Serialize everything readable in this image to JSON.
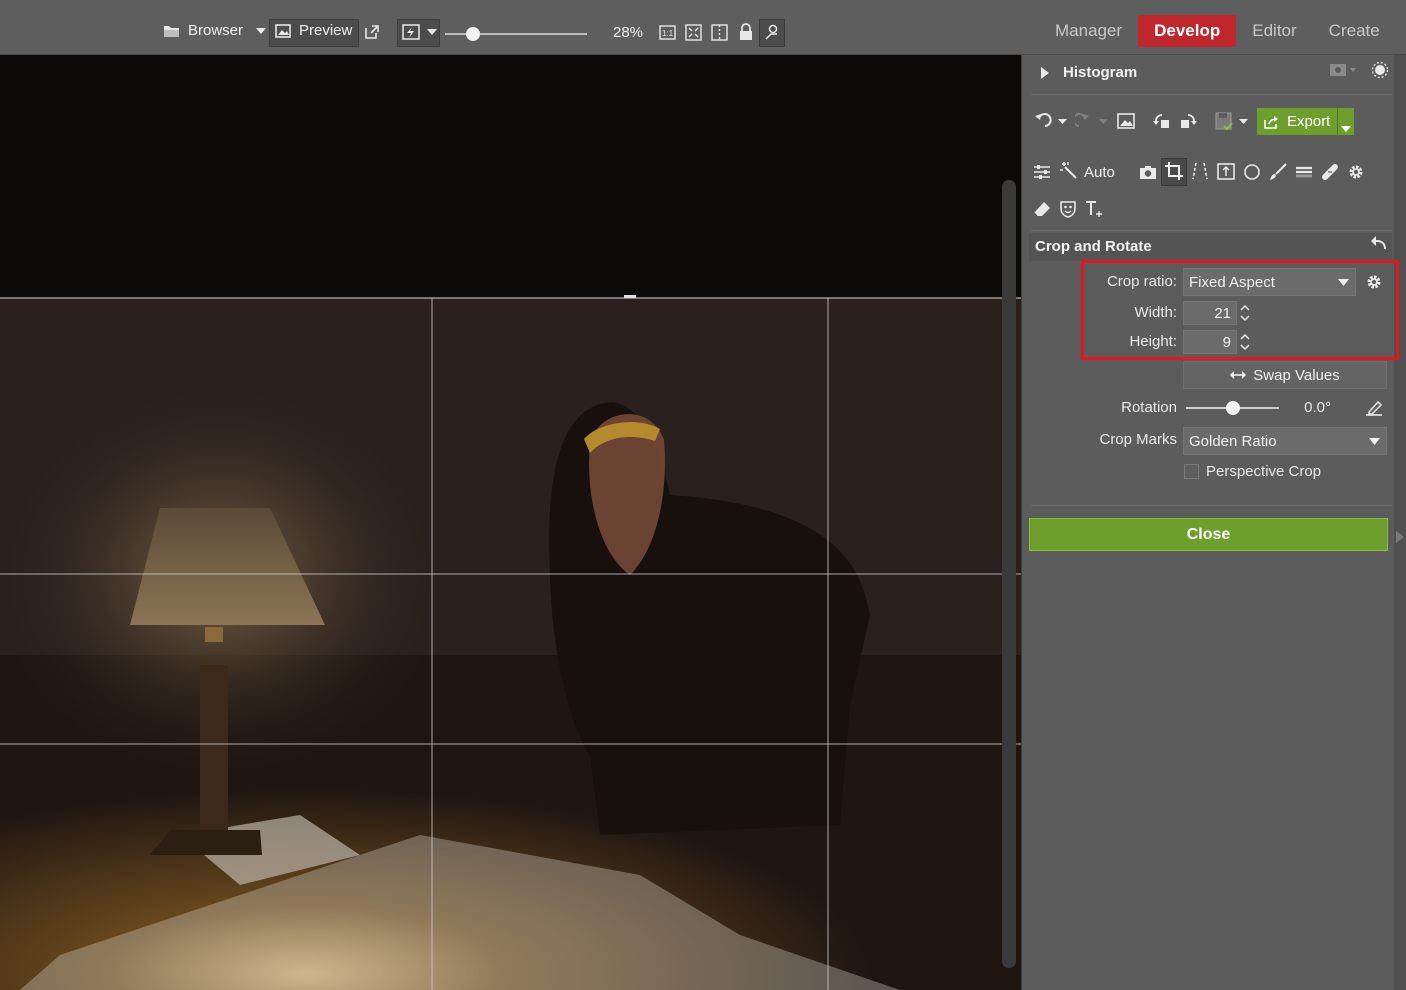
{
  "toolbar": {
    "browser_label": "Browser",
    "preview_label": "Preview",
    "zoom_level": "28%",
    "zoom_slider_value": 0.2
  },
  "modes": [
    {
      "label": "Manager",
      "active": false
    },
    {
      "label": "Develop",
      "active": true
    },
    {
      "label": "Editor",
      "active": false
    },
    {
      "label": "Create",
      "active": false
    }
  ],
  "panel": {
    "histogram_title": "Histogram",
    "export_label": "Export",
    "auto_label": "Auto",
    "section_title": "Crop and Rotate",
    "crop_ratio_label": "Crop ratio:",
    "crop_ratio_value": "Fixed Aspect",
    "width_label": "Width:",
    "width_value": "21",
    "height_label": "Height:",
    "height_value": "9",
    "swap_label": "Swap Values",
    "rotation_label": "Rotation",
    "rotation_value": "0.0°",
    "rotation_slider_value": 0.5,
    "crop_marks_label": "Crop Marks",
    "crop_marks_value": "Golden Ratio",
    "perspective_label": "Perspective Crop",
    "perspective_checked": false,
    "close_label": "Close"
  },
  "colors": {
    "active_mode": "#c0272d",
    "export_green": "#6e9f2c",
    "highlight_red": "#e8161a"
  }
}
